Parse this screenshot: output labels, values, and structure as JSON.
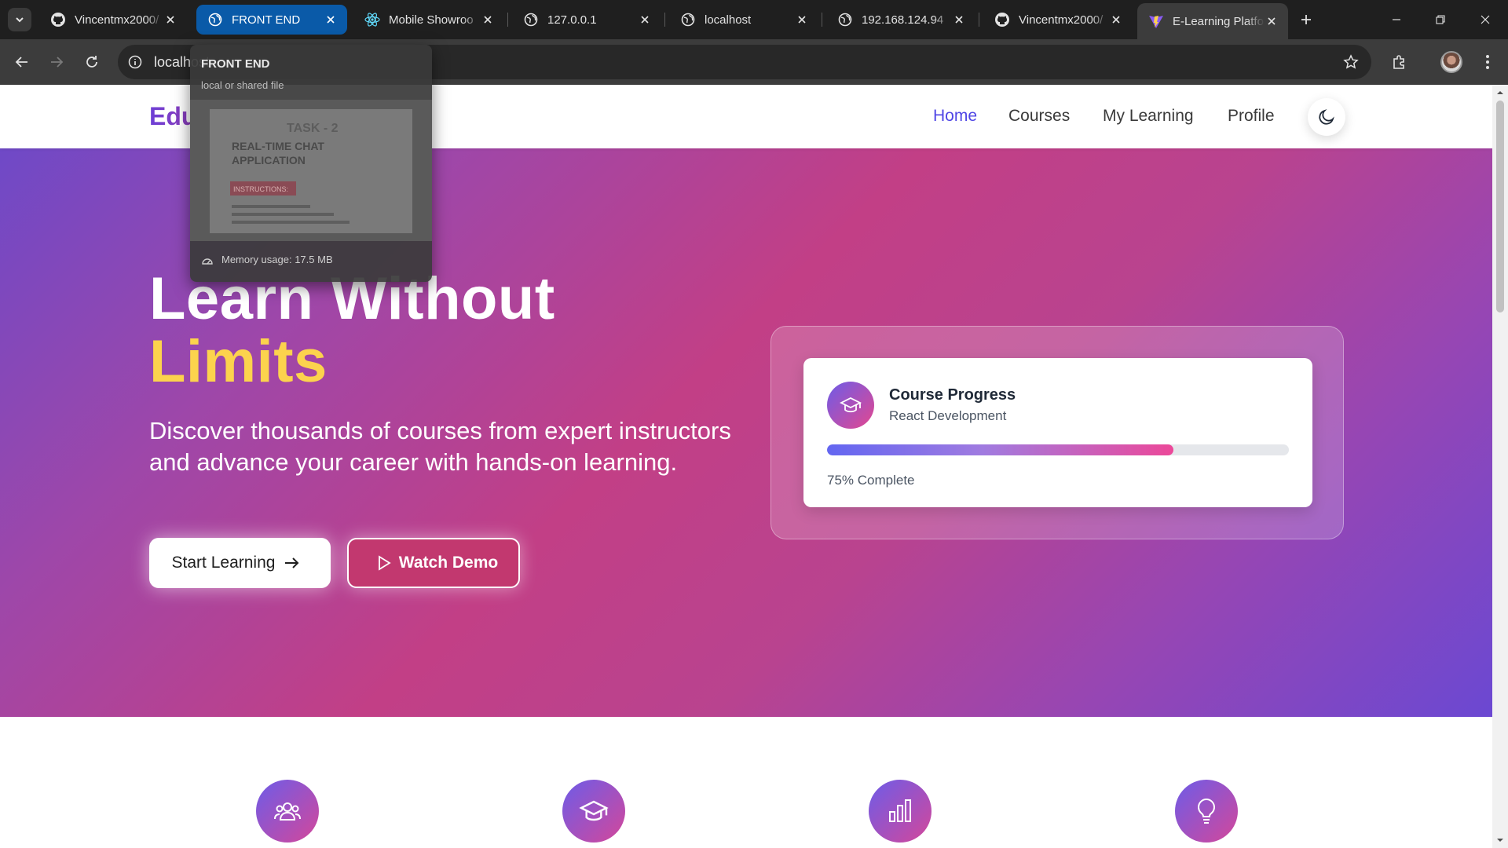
{
  "browser": {
    "tabs": [
      {
        "title": "Vincentmx2000/",
        "icon": "github-icon"
      },
      {
        "title": "FRONT END",
        "icon": "globe-icon"
      },
      {
        "title": "Mobile Showroo",
        "icon": "react-icon"
      },
      {
        "title": "127.0.0.1",
        "icon": "globe-icon"
      },
      {
        "title": "localhost",
        "icon": "globe-icon"
      },
      {
        "title": "192.168.124.94",
        "icon": "globe-icon"
      },
      {
        "title": "Vincentmx2000/",
        "icon": "github-icon"
      },
      {
        "title": "E-Learning Platfo",
        "icon": "vite-icon"
      }
    ],
    "address": "localhost",
    "hover_card": {
      "title": "FRONT END",
      "subtitle": "local or shared file",
      "preview_heading": "TASK - 2",
      "preview_title_line1": "REAL-TIME CHAT",
      "preview_title_line2": "APPLICATION",
      "preview_badge": "INSTRUCTIONS:",
      "memory": "Memory usage: 17.5 MB"
    }
  },
  "site": {
    "logo": "EduLearn",
    "nav": [
      "Home",
      "Courses",
      "My Learning",
      "Profile"
    ],
    "active_nav": "Home"
  },
  "hero": {
    "heading_line1": "Learn Without",
    "heading_line2": "Limits",
    "description": "Discover thousands of courses from expert instructors and advance your career with hands-on learning.",
    "primary_button": "Start Learning",
    "secondary_button": "Watch Demo"
  },
  "progress_card": {
    "title": "Course Progress",
    "course": "React Development",
    "percent": 75,
    "label": "75% Complete"
  },
  "features": [
    {
      "icon": "users-icon"
    },
    {
      "icon": "graduation-cap-icon"
    },
    {
      "icon": "bar-chart-icon"
    },
    {
      "icon": "lightbulb-icon"
    }
  ],
  "colors": {
    "brand_indigo": "#4f46e5",
    "accent_yellow": "#fcd34d",
    "demo_button": "#c2386f",
    "hover_tab": "#0a5aa8"
  }
}
